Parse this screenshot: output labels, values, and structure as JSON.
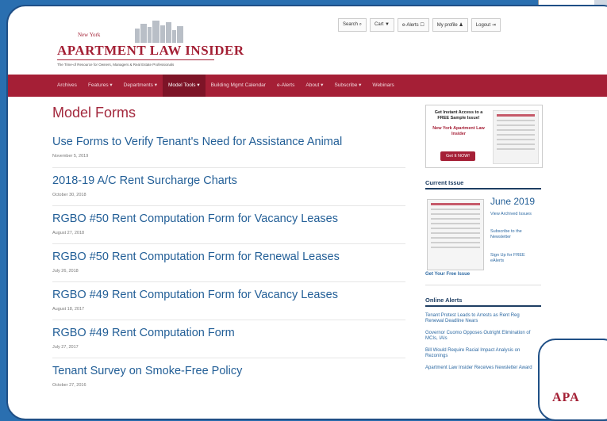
{
  "header": {
    "logo_small": "New York",
    "logo_title": "APARTMENT LAW INSIDER",
    "logo_tagline": "The Time-of Resource for Owners, Managers & Real Estate Professionals"
  },
  "utility": [
    "Search ⌕",
    "Cart ▼",
    "e-Alerts ☐",
    "My profile ♟",
    "Logout ⇥"
  ],
  "nav": {
    "items": [
      "Archives",
      "Features ▾",
      "Departments ▾",
      "Model Tools ▾",
      "Building Mgmt Calendar",
      "e-Alerts",
      "About ▾",
      "Subscribe ▾",
      "Webinars"
    ],
    "active_index": 3
  },
  "main": {
    "title": "Model Forms",
    "articles": [
      {
        "title": "Use Forms to Verify Tenant's Need for Assistance Animal",
        "date": "November 5, 2019"
      },
      {
        "title": "2018-19 A/C Rent Surcharge Charts",
        "date": "October 30, 2018"
      },
      {
        "title": "RGBO #50 Rent Computation Form for Vacancy Leases",
        "date": "August 27, 2018"
      },
      {
        "title": "RGBO #50 Rent Computation Form for Renewal Leases",
        "date": "July 26, 2018"
      },
      {
        "title": "RGBO #49 Rent Computation Form for Vacancy Leases",
        "date": "August 18, 2017"
      },
      {
        "title": "RGBO #49 Rent Computation Form",
        "date": "July 27, 2017"
      },
      {
        "title": "Tenant Survey on Smoke-Free Policy",
        "date": "October 27, 2016"
      }
    ]
  },
  "sidebar": {
    "promo_text": "Get Instant Access to a FREE Sample Issue!",
    "promo_red": "New York Apartment Law Insider",
    "promo_button": "Get It NOW!",
    "current_issue_heading": "Current Issue",
    "issue_month": "June 2019",
    "issue_links": [
      "View Archived Issues",
      "Subscribe to the Newsletter",
      "Sign Up for FREE eAlerts"
    ],
    "free_issue_link": "Get Your Free Issue",
    "online_alerts_heading": "Online Alerts",
    "alerts": [
      "Tenant Protest Leads to Arrests as Rent Reg Renewal Deadline Nears",
      "Governor Cuomo Opposes Outright Elimination of MCIs, IAIs",
      "Bill Would Require Racial Impact Analysis on Rezonings",
      "Apartment Law Insider Receives Newsletter Award"
    ]
  },
  "corner_logo_fragment": "APA",
  "colors": {
    "brand_red": "#a51f36",
    "link_blue": "#235f97",
    "frame_blue": "#1f4f86"
  }
}
